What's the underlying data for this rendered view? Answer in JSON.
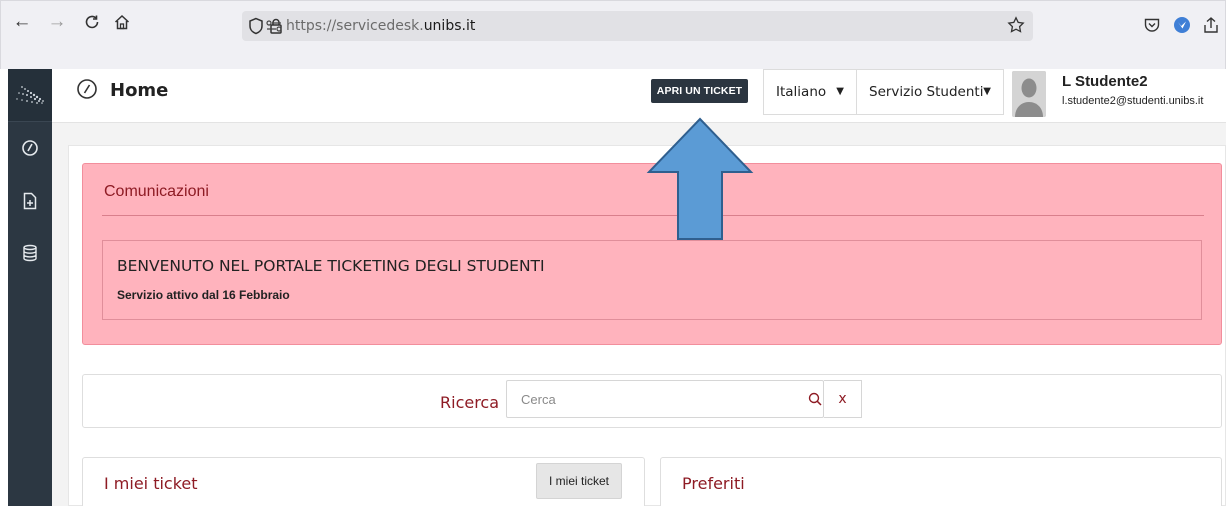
{
  "browser": {
    "url_prefix": "https://servicedesk.",
    "url_domain": "unibs.it"
  },
  "header": {
    "page_title": "Home",
    "open_ticket_label": "APRI UN TICKET",
    "language": "Italiano",
    "service": "Servizio Studenti",
    "user_name": "L Studente2",
    "user_email": "l.studente2@studenti.unibs.it"
  },
  "communications": {
    "title": "Comunicazioni",
    "headline": "BENVENUTO NEL PORTALE TICKETING DEGLI STUDENTI",
    "subtext": "Servizio attivo dal 16 Febbraio"
  },
  "search": {
    "label": "Ricerca",
    "placeholder": "Cerca",
    "clear_label": "x"
  },
  "cards": {
    "my_tickets_title": "I miei ticket",
    "my_tickets_button": "I miei ticket",
    "favorites_title": "Preferiti"
  },
  "colors": {
    "accent_red": "#8e1b24",
    "alert_bg": "#ffb3bd",
    "sidebar_bg": "#2c3742",
    "arrow_blue": "#5b9bd5"
  },
  "icons": {
    "back": "back-arrow-icon",
    "forward": "forward-arrow-icon",
    "reload": "reload-icon",
    "home": "home-icon",
    "shield": "shield-icon",
    "lock": "lock-icon",
    "permissions": "permissions-icon",
    "bookmark_star": "bookmark-star-icon",
    "pocket": "pocket-icon",
    "extension": "extension-icon",
    "share": "share-icon",
    "dashboard": "dashboard-icon",
    "new_doc": "new-document-icon",
    "database": "database-icon",
    "search": "search-icon"
  }
}
